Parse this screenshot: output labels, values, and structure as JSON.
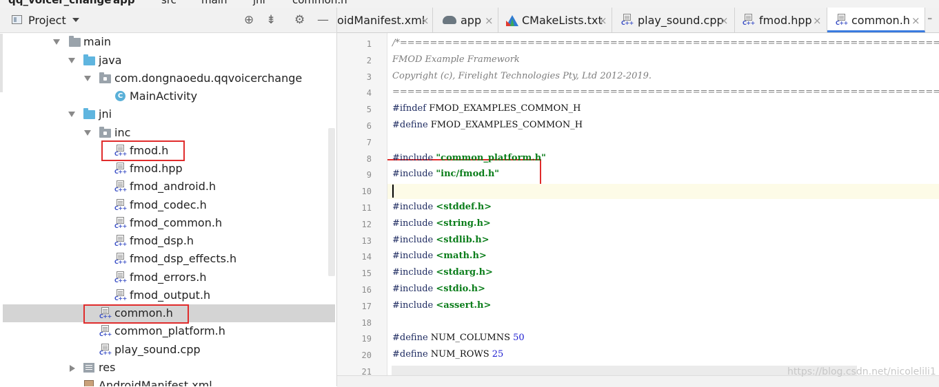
{
  "breadcrumb": [
    "qq_voicer_change",
    "app",
    "src",
    "main",
    "jni",
    "common.h"
  ],
  "project_panel": {
    "title": "Project",
    "toolbar_icons": [
      "locate-icon",
      "collapse-icon",
      "gear-icon",
      "minimize-icon"
    ],
    "tree": [
      {
        "label": "main",
        "icon": "folder-grey"
      },
      {
        "label": "java",
        "icon": "folder-blue"
      },
      {
        "label": "com.dongnaoedu.qqvoicerchange",
        "icon": "package"
      },
      {
        "label": "MainActivity",
        "icon": "class"
      },
      {
        "label": "jni",
        "icon": "folder-blue"
      },
      {
        "label": "inc",
        "icon": "package"
      },
      {
        "label": "fmod.h",
        "icon": "cpp"
      },
      {
        "label": "fmod.hpp",
        "icon": "cpp"
      },
      {
        "label": "fmod_android.h",
        "icon": "cpp"
      },
      {
        "label": "fmod_codec.h",
        "icon": "cpp"
      },
      {
        "label": "fmod_common.h",
        "icon": "cpp"
      },
      {
        "label": "fmod_dsp.h",
        "icon": "cpp"
      },
      {
        "label": "fmod_dsp_effects.h",
        "icon": "cpp"
      },
      {
        "label": "fmod_errors.h",
        "icon": "cpp"
      },
      {
        "label": "fmod_output.h",
        "icon": "cpp"
      },
      {
        "label": "common.h",
        "icon": "cpp",
        "selected": true
      },
      {
        "label": "common_platform.h",
        "icon": "cpp"
      },
      {
        "label": "play_sound.cpp",
        "icon": "cpp"
      },
      {
        "label": "res",
        "icon": "res"
      },
      {
        "label": "AndroidManifest.xml",
        "icon": "xml"
      }
    ]
  },
  "editor": {
    "tabs": [
      {
        "label": "oidManifest.xml",
        "active": false
      },
      {
        "label": "app",
        "active": false
      },
      {
        "label": "CMakeLists.txt",
        "active": false
      },
      {
        "label": "play_sound.cpp",
        "active": false
      },
      {
        "label": "fmod.hpp",
        "active": false
      },
      {
        "label": "common.h",
        "active": true
      }
    ],
    "tab_close": "×",
    "tab_overflow": "⁼",
    "lines": [
      {
        "n": "1",
        "parts": [
          [
            "cm",
            "/*==========================================================================="
          ]
        ]
      },
      {
        "n": "2",
        "parts": [
          [
            "cm",
            "FMOD Example Framework"
          ]
        ]
      },
      {
        "n": "3",
        "parts": [
          [
            "cm",
            "Copyright (c), Firelight Technologies Pty, Ltd 2012-2019."
          ]
        ]
      },
      {
        "n": "4",
        "parts": [
          [
            "cm",
            "===========================================================================*/"
          ]
        ]
      },
      {
        "n": "5",
        "parts": [
          [
            "pp",
            "#ifndef "
          ],
          [
            "",
            "FMOD_EXAMPLES_COMMON_H"
          ]
        ]
      },
      {
        "n": "6",
        "parts": [
          [
            "pp",
            "#define "
          ],
          [
            "",
            "FMOD_EXAMPLES_COMMON_H"
          ]
        ]
      },
      {
        "n": "7",
        "parts": []
      },
      {
        "n": "8",
        "parts": [
          [
            "pp",
            "#include "
          ],
          [
            "str",
            "\"common_platform.h\""
          ]
        ]
      },
      {
        "n": "9",
        "parts": [
          [
            "pp",
            "#include "
          ],
          [
            "str",
            "\"inc/fmod.h\""
          ]
        ]
      },
      {
        "n": "10",
        "parts": []
      },
      {
        "n": "11",
        "parts": [
          [
            "pp",
            "#include "
          ],
          [
            "str",
            "<stddef.h>"
          ]
        ]
      },
      {
        "n": "12",
        "parts": [
          [
            "pp",
            "#include "
          ],
          [
            "str",
            "<string.h>"
          ]
        ]
      },
      {
        "n": "13",
        "parts": [
          [
            "pp",
            "#include "
          ],
          [
            "str",
            "<stdlib.h>"
          ]
        ]
      },
      {
        "n": "14",
        "parts": [
          [
            "pp",
            "#include "
          ],
          [
            "str",
            "<math.h>"
          ]
        ]
      },
      {
        "n": "15",
        "parts": [
          [
            "pp",
            "#include "
          ],
          [
            "str",
            "<stdarg.h>"
          ]
        ]
      },
      {
        "n": "16",
        "parts": [
          [
            "pp",
            "#include "
          ],
          [
            "str",
            "<stdio.h>"
          ]
        ]
      },
      {
        "n": "17",
        "parts": [
          [
            "pp",
            "#include "
          ],
          [
            "str",
            "<assert.h>"
          ]
        ]
      },
      {
        "n": "18",
        "parts": []
      },
      {
        "n": "19",
        "parts": [
          [
            "pp",
            "#define "
          ],
          [
            "",
            "NUM_COLUMNS "
          ],
          [
            "num",
            "50"
          ]
        ]
      },
      {
        "n": "20",
        "parts": [
          [
            "pp",
            "#define "
          ],
          [
            "",
            "NUM_ROWS "
          ],
          [
            "num",
            "25"
          ]
        ]
      },
      {
        "n": "21",
        "parts": []
      }
    ]
  },
  "watermark": "https://blog.csdn.net/nicolelili1",
  "colors": {
    "highlight_box": "#e02b2b",
    "active_tab_underline": "#3a7be0",
    "string": "#0a7d1a",
    "number": "#1a1ad0"
  }
}
